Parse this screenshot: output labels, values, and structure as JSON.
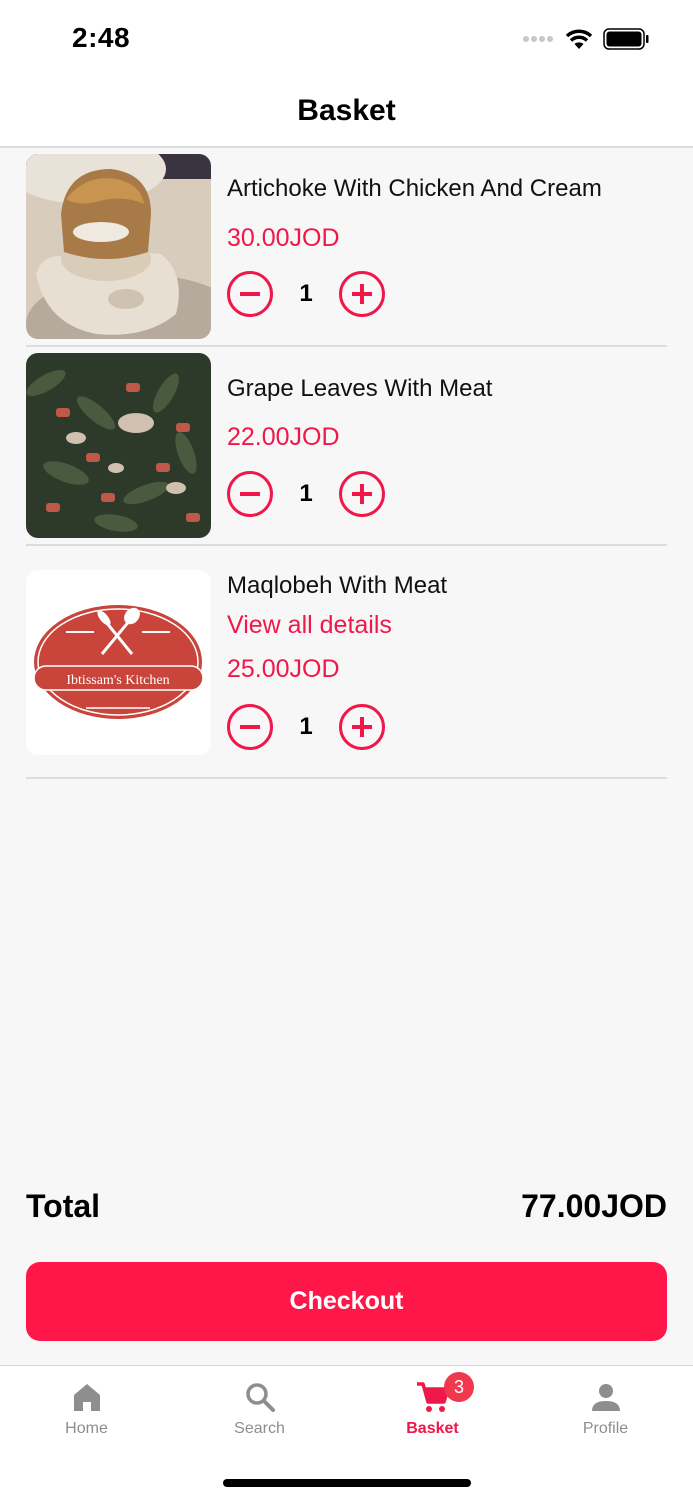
{
  "status": {
    "time": "2:48"
  },
  "header": {
    "title": "Basket"
  },
  "items": [
    {
      "name": "Artichoke With Chicken And Cream",
      "price": "30.00JOD",
      "quantity": "1"
    },
    {
      "name": "Grape Leaves With Meat",
      "price": "22.00JOD",
      "quantity": "1"
    },
    {
      "name": "Maqlobeh With Meat",
      "link": "View all details",
      "price": "25.00JOD",
      "quantity": "1",
      "logo_text": "Ibtissam's Kitchen"
    }
  ],
  "summary": {
    "total_label": "Total",
    "total_value": "77.00JOD"
  },
  "checkout": {
    "label": "Checkout"
  },
  "tabs": [
    {
      "label": "Home",
      "icon": "home-icon"
    },
    {
      "label": "Search",
      "icon": "search-icon"
    },
    {
      "label": "Basket",
      "icon": "cart-icon",
      "badge": "3",
      "active": true
    },
    {
      "label": "Profile",
      "icon": "person-icon"
    }
  ],
  "colors": {
    "accent": "#f0184a",
    "checkout": "#fe1748",
    "badge": "#f0394e",
    "background": "#f7f7f7"
  }
}
